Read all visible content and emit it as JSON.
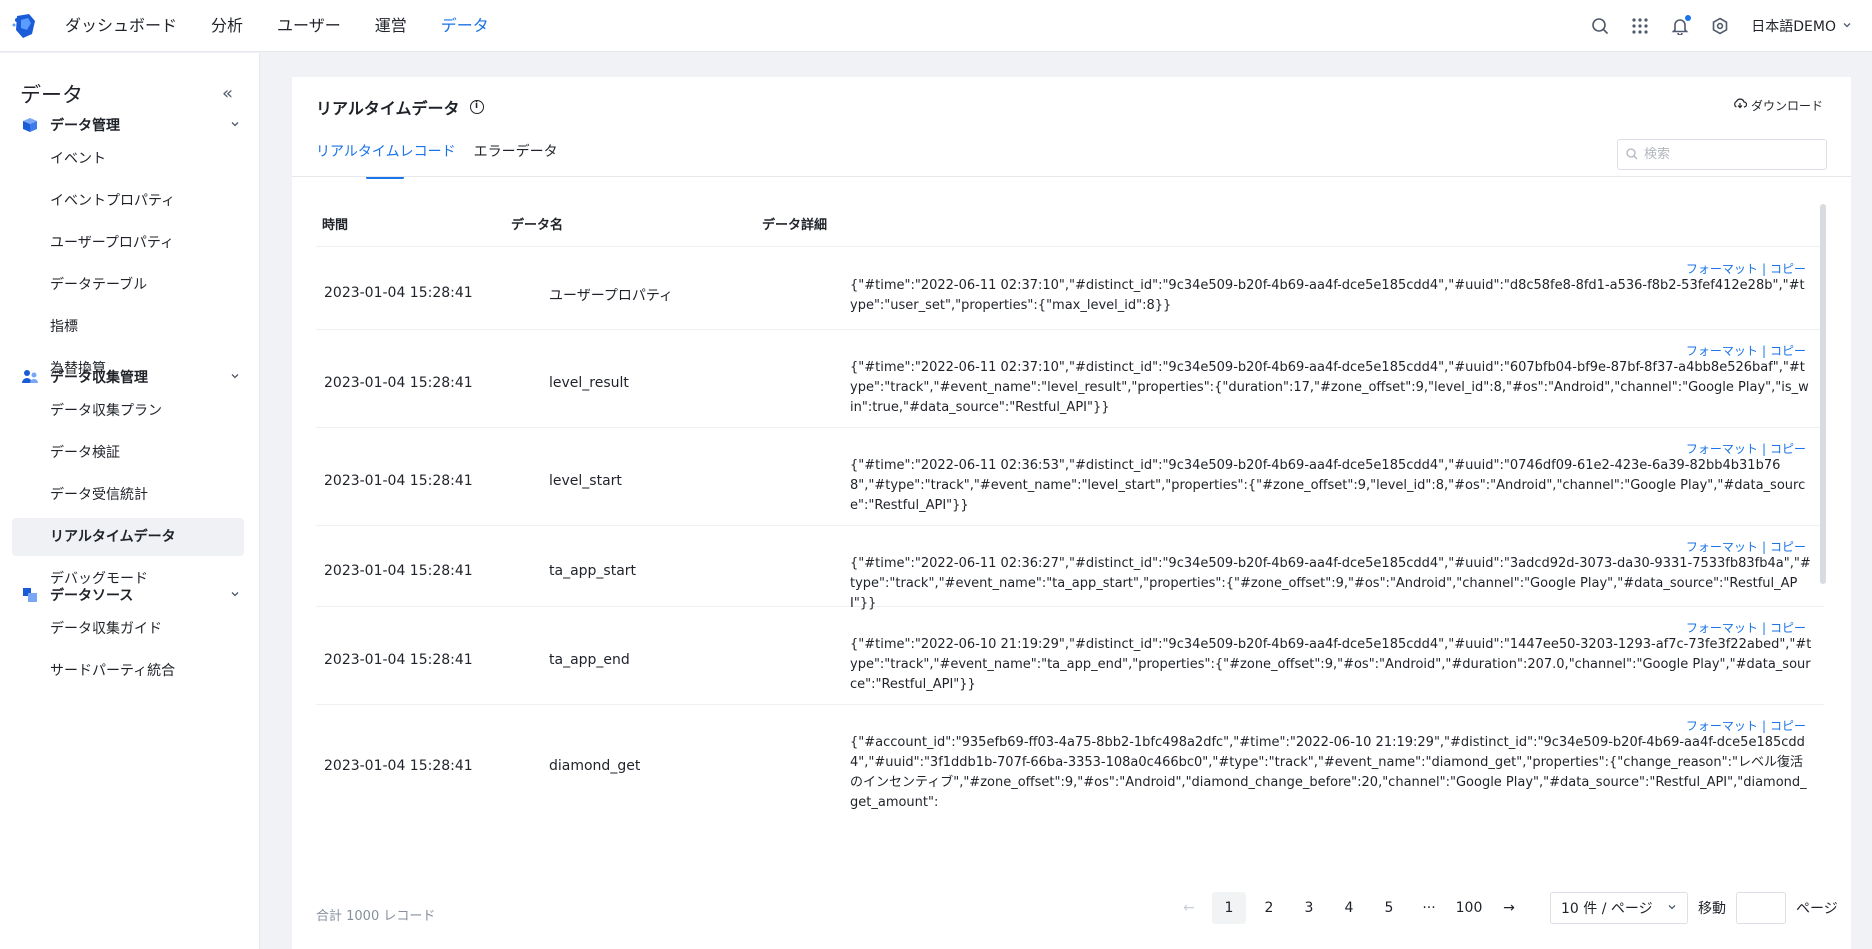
{
  "nav": {
    "items": [
      "ダッシュボード",
      "分析",
      "ユーザー",
      "運営",
      "データ"
    ],
    "active_index": 4,
    "user": "日本語DEMO",
    "accent": "#1a73e8"
  },
  "sidebar": {
    "title": "データ",
    "groups": [
      {
        "label": "データ管理",
        "icon": "cube-icon",
        "items": [
          "イベント",
          "イベントプロパティ",
          "ユーザープロパティ",
          "データテーブル",
          "指標",
          "為替換算"
        ]
      },
      {
        "label": "データ収集管理",
        "icon": "users-icon",
        "items": [
          "データ収集プラン",
          "データ検証",
          "データ受信統計",
          "リアルタイムデータ",
          "デバッグモード"
        ]
      },
      {
        "label": "データソース",
        "icon": "source-icon",
        "items": [
          "データ収集ガイド",
          "サードパーティ統合"
        ]
      }
    ],
    "active_item": "リアルタイムデータ"
  },
  "main": {
    "title": "リアルタイムデータ",
    "download_label": "ダウンロード",
    "tabs": [
      "リアルタイムレコード",
      "エラーデータ"
    ],
    "search_placeholder": "検索",
    "columns": [
      "時間",
      "データ名",
      "データ詳細"
    ],
    "action_format": "フォーマット",
    "action_copy": "コピー",
    "rows": [
      {
        "time": "2023-01-04 15:28:41",
        "name": "ユーザープロパティ",
        "detail": "{\"#time\":\"2022-06-11 02:37:10\",\"#distinct_id\":\"9c34e509-b20f-4b69-aa4f-dce5e185cdd4\",\"#uuid\":\"d8c58fe8-8fd1-a536-f8b2-53fef412e28b\",\"#type\":\"user_set\",\"properties\":{\"max_level_id\":8}}"
      },
      {
        "time": "2023-01-04 15:28:41",
        "name": "level_result",
        "detail": "{\"#time\":\"2022-06-11 02:37:10\",\"#distinct_id\":\"9c34e509-b20f-4b69-aa4f-dce5e185cdd4\",\"#uuid\":\"607bfb04-bf9e-87bf-8f37-a4bb8e526baf\",\"#type\":\"track\",\"#event_name\":\"level_result\",\"properties\":{\"duration\":17,\"#zone_offset\":9,\"level_id\":8,\"#os\":\"Android\",\"channel\":\"Google Play\",\"is_win\":true,\"#data_source\":\"Restful_API\"}}"
      },
      {
        "time": "2023-01-04 15:28:41",
        "name": "level_start",
        "detail": "{\"#time\":\"2022-06-11 02:36:53\",\"#distinct_id\":\"9c34e509-b20f-4b69-aa4f-dce5e185cdd4\",\"#uuid\":\"0746df09-61e2-423e-6a39-82bb4b31b768\",\"#type\":\"track\",\"#event_name\":\"level_start\",\"properties\":{\"#zone_offset\":9,\"level_id\":8,\"#os\":\"Android\",\"channel\":\"Google Play\",\"#data_source\":\"Restful_API\"}}"
      },
      {
        "time": "2023-01-04 15:28:41",
        "name": "ta_app_start",
        "detail": "{\"#time\":\"2022-06-11 02:36:27\",\"#distinct_id\":\"9c34e509-b20f-4b69-aa4f-dce5e185cdd4\",\"#uuid\":\"3adcd92d-3073-da30-9331-7533fb83fb4a\",\"#type\":\"track\",\"#event_name\":\"ta_app_start\",\"properties\":{\"#zone_offset\":9,\"#os\":\"Android\",\"channel\":\"Google Play\",\"#data_source\":\"Restful_API\"}}"
      },
      {
        "time": "2023-01-04 15:28:41",
        "name": "ta_app_end",
        "detail": "{\"#time\":\"2022-06-10 21:19:29\",\"#distinct_id\":\"9c34e509-b20f-4b69-aa4f-dce5e185cdd4\",\"#uuid\":\"1447ee50-3203-1293-af7c-73fe3f22abed\",\"#type\":\"track\",\"#event_name\":\"ta_app_end\",\"properties\":{\"#zone_offset\":9,\"#os\":\"Android\",\"#duration\":207.0,\"channel\":\"Google Play\",\"#data_source\":\"Restful_API\"}}"
      },
      {
        "time": "2023-01-04 15:28:41",
        "name": "diamond_get",
        "detail": "{\"#account_id\":\"935efb69-ff03-4a75-8bb2-1bfc498a2dfc\",\"#time\":\"2022-06-10 21:19:29\",\"#distinct_id\":\"9c34e509-b20f-4b69-aa4f-dce5e185cdd4\",\"#uuid\":\"3f1ddb1b-707f-66ba-3353-108a0c466bc0\",\"#type\":\"track\",\"#event_name\":\"diamond_get\",\"properties\":{\"change_reason\":\"レベル復活のインセンティブ\",\"#zone_offset\":9,\"#os\":\"Android\",\"diamond_change_before\":20,\"channel\":\"Google Play\",\"#data_source\":\"Restful_API\",\"diamond_get_amount\":"
      }
    ],
    "total_label": "合計 1000 レコード",
    "pages": [
      "1",
      "2",
      "3",
      "4",
      "5",
      "···",
      "100"
    ],
    "page_size": "10 件 / ページ",
    "jump_label": "移動",
    "jump_suffix": "ページ"
  }
}
